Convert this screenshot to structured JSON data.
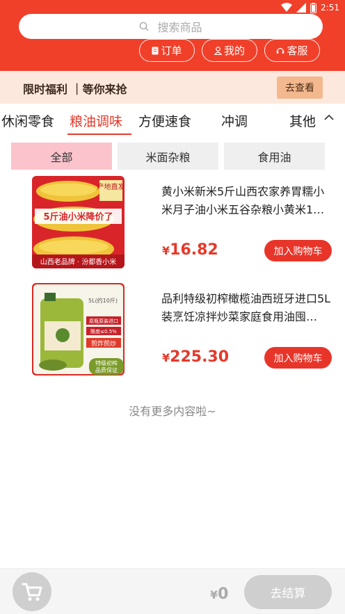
{
  "status_bar": {
    "time": "2:51",
    "icons": [
      "wifi-icon",
      "signal-icon",
      "battery-icon"
    ]
  },
  "search": {
    "placeholder": "搜索商品",
    "icon": "search-icon"
  },
  "header_links": [
    {
      "label": "订单",
      "icon": "order-icon"
    },
    {
      "label": "我的",
      "icon": "user-icon"
    },
    {
      "label": "客服",
      "icon": "headset-icon"
    }
  ],
  "promo": {
    "text": "限时福利 ｜等你来抢",
    "button": "去查看"
  },
  "category_tabs": [
    "休闲零食",
    "粮油调味",
    "方便速食",
    "冲调",
    "其他"
  ],
  "active_tab": "粮油调味",
  "subcategories": [
    "全部",
    "米面杂粮",
    "食用油"
  ],
  "active_subcategory": "全部",
  "products": [
    {
      "title": "黄小米新米5斤山西农家养胃糯小米月子油小米五谷杂粮小黄米1…",
      "currency": "¥",
      "price": "16.82",
      "button": "加入购物车",
      "image_text": {
        "top": "产地直发",
        "main": "5斤油小米降价了",
        "bottom": "山西老品牌 · 汾都香小米"
      }
    },
    {
      "title": "品利特级初榨橄榄油西班牙进口5L装烹饪凉拌炒菜家庭食用油囤…",
      "currency": "¥",
      "price": "225.30",
      "button": "加入购物车",
      "image_text": {
        "volume": "5L(约10斤)",
        "tag1": "原瓶原装进口",
        "tag2": "酸度≤0.5%",
        "tag3": "煎炸煎炒",
        "tag4": "特级初榨",
        "tag5": "品质保证"
      }
    }
  ],
  "no_more": "没有更多内容啦~",
  "bottom_bar": {
    "currency": "¥",
    "total": "0",
    "checkout": "去结算",
    "cart_icon": "cart-icon"
  },
  "colors": {
    "brand_red": "#f0402a",
    "price_red": "#e5392a",
    "promo_bg": "#fde8dd",
    "subcat_active": "#fbc3cc"
  }
}
